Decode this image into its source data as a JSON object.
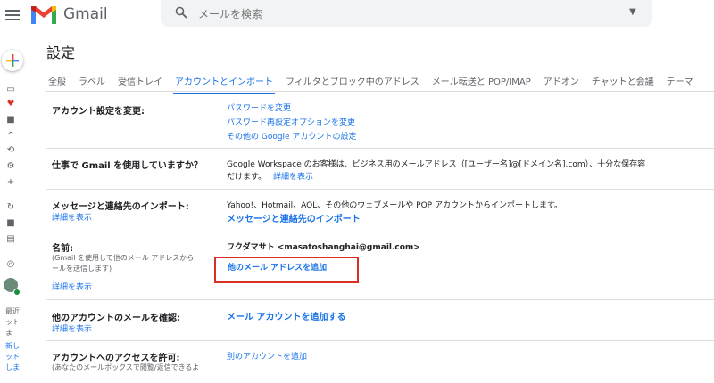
{
  "header": {
    "app_name": "Gmail",
    "search_placeholder": "メールを検索"
  },
  "page": {
    "title": "設定"
  },
  "tabs": [
    {
      "label": "全般"
    },
    {
      "label": "ラベル"
    },
    {
      "label": "受信トレイ"
    },
    {
      "label": "アカウントとインポート",
      "active": true
    },
    {
      "label": "フィルタとブロック中のアドレス"
    },
    {
      "label": "メール転送と POP/IMAP"
    },
    {
      "label": "アドオン"
    },
    {
      "label": "チャットと会議"
    },
    {
      "label": "テーマ"
    }
  ],
  "sections": {
    "account_settings": {
      "label": "アカウント設定を変更:",
      "links": [
        "パスワードを変更",
        "パスワード再設定オプションを変更",
        "その他の Google アカウントの設定"
      ]
    },
    "work": {
      "label": "仕事で Gmail を使用していますか？",
      "text1": "Google Workspace のお客様は、ビジネス用のメールアドレス（[ユーザー名]@[ドメイン名].com）、十分な保存容",
      "text2": "だけます。",
      "details": "詳細を表示"
    },
    "import": {
      "label": "メッセージと連絡先のインポート:",
      "details": "詳細を表示",
      "text": "Yahoo!、Hotmail、AOL、その他のウェブメールや POP アカウントからインポートします。",
      "link": "メッセージと連絡先のインポート"
    },
    "name": {
      "label": "名前:",
      "sub1": "(Gmail を使用して他のメール アドレスから",
      "sub2": "ールを送信します)",
      "details": "詳細を表示",
      "value": "フクダマサト <masatoshanghai@gmail.com>",
      "link": "他のメール アドレスを追加"
    },
    "check_mail": {
      "label": "他のアカウントのメールを確認:",
      "details": "詳細を表示",
      "link": "メール アカウントを追加する"
    },
    "grant_access": {
      "label": "アカウントへのアクセスを許可:",
      "sub": "(あなたのメールボックスで閲覧/返信できるよ",
      "link": "別のアカウントを追加"
    }
  },
  "leftrail": {
    "items": [
      "最近",
      "ット",
      "ま",
      "新し",
      "ット",
      "しま"
    ]
  },
  "colors": {
    "accent": "#1a73e8",
    "highlight_box": "#d93025"
  }
}
